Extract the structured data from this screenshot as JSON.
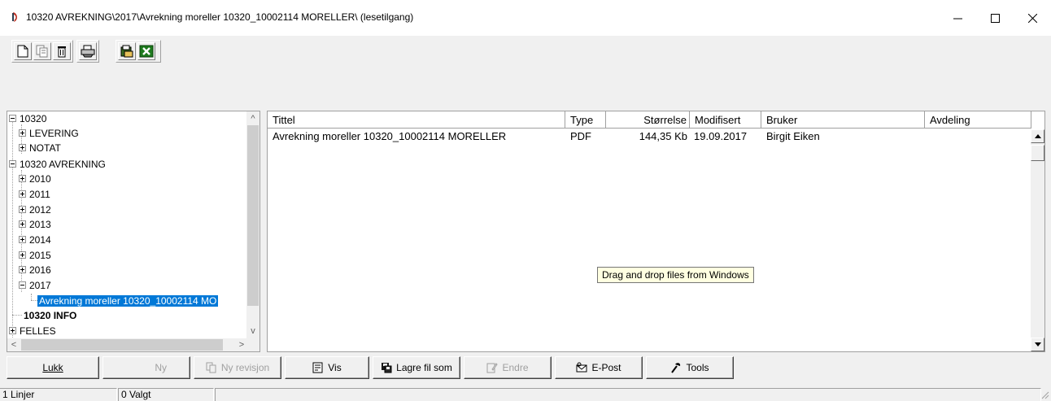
{
  "window": {
    "title": "10320 AVREKNING\\2017\\Avrekning moreller 10320_10002114 MORELLER\\ (lesetilgang)",
    "controls": {
      "minimize": "minimize",
      "maximize": "maximize",
      "close": "close"
    }
  },
  "toolbar": {
    "buttons": [
      {
        "name": "new-document",
        "icon": "new-document-icon"
      },
      {
        "name": "copy-document",
        "icon": "copy-icon"
      },
      {
        "name": "delete-document",
        "icon": "trash-icon"
      },
      {
        "name": "print",
        "icon": "printer-icon"
      },
      {
        "name": "archive",
        "icon": "archive-icon"
      },
      {
        "name": "excel-export",
        "icon": "excel-icon"
      }
    ]
  },
  "tree": {
    "nodes": [
      {
        "label": "10320",
        "level": 0,
        "state": "expanded"
      },
      {
        "label": "LEVERING",
        "level": 1,
        "state": "collapsed"
      },
      {
        "label": "NOTAT",
        "level": 1,
        "state": "collapsed"
      },
      {
        "label": "10320 AVREKNING",
        "level": 0,
        "state": "expanded"
      },
      {
        "label": "2010",
        "level": 1,
        "state": "collapsed"
      },
      {
        "label": "2011",
        "level": 1,
        "state": "collapsed"
      },
      {
        "label": "2012",
        "level": 1,
        "state": "collapsed"
      },
      {
        "label": "2013",
        "level": 1,
        "state": "collapsed"
      },
      {
        "label": "2014",
        "level": 1,
        "state": "collapsed"
      },
      {
        "label": "2015",
        "level": 1,
        "state": "collapsed"
      },
      {
        "label": "2016",
        "level": 1,
        "state": "collapsed"
      },
      {
        "label": "2017",
        "level": 1,
        "state": "expanded"
      },
      {
        "label": "Avrekning moreller 10320_10002114 MO",
        "level": 2,
        "state": "leaf",
        "selected": true
      },
      {
        "label": "10320 INFO",
        "level": 0,
        "state": "leaf",
        "bold": true
      },
      {
        "label": "FELLES",
        "level": 0,
        "state": "collapsed"
      }
    ]
  },
  "list": {
    "columns": [
      "Tittel",
      "Type",
      "Størrelse",
      "Modifisert",
      "Bruker",
      "Avdeling"
    ],
    "rows": [
      {
        "title": "Avrekning moreller 10320_10002114 MORELLER",
        "type": "PDF",
        "size": "144,35 Kb",
        "modified": "19.09.2017",
        "user": "Birgit Eiken",
        "department": ""
      }
    ],
    "tooltip": "Drag and drop files from Windows"
  },
  "buttons": {
    "close": "Lukk",
    "new": "Ny",
    "new_revision": "Ny revisjon",
    "view": "Vis",
    "save_as": "Lagre fil som",
    "edit": "Endre",
    "email": "E-Post",
    "tools": "Tools"
  },
  "status": {
    "lines": "1 Linjer",
    "selected": "0 Valgt"
  },
  "colors": {
    "selection": "#0078d7",
    "tooltip_bg": "#ffffe1",
    "window_bg": "#f0f0f0"
  }
}
